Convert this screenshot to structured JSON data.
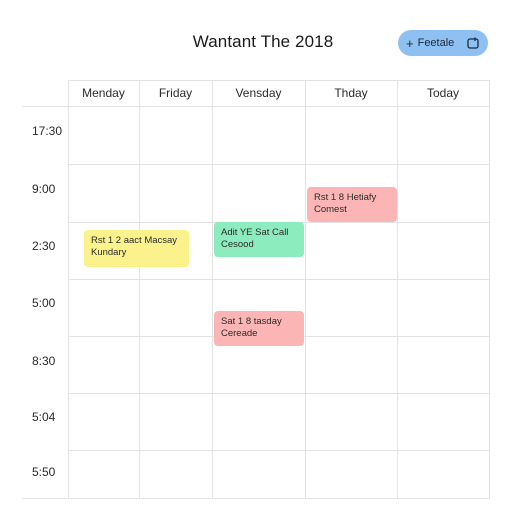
{
  "header": {
    "title": "Wantant The 2018",
    "create_button": {
      "plus": "+",
      "label": "Feetale",
      "icon": "calendar-icon"
    }
  },
  "calendar": {
    "days": [
      "Menday",
      "Friday",
      "Vensday",
      "Thday",
      "Today"
    ],
    "times": [
      "17:30",
      "9:00",
      "2:30",
      "5:00",
      "8:30",
      "5:04",
      "5:50"
    ],
    "events": [
      {
        "line1": "Rst 1 2 aact Macsay",
        "line2": "Kundary",
        "color": "#fbf28c"
      },
      {
        "line1": "Adit YE Sat Call",
        "line2": "Cesood",
        "color": "#8cecbd"
      },
      {
        "line1": "Rst 1 8 Hetiafy",
        "line2": "Comest",
        "color": "#fbb5b5"
      },
      {
        "line1": "Sat 1 8 tasday",
        "line2": "Cereade",
        "color": "#fbb5b5"
      }
    ]
  }
}
